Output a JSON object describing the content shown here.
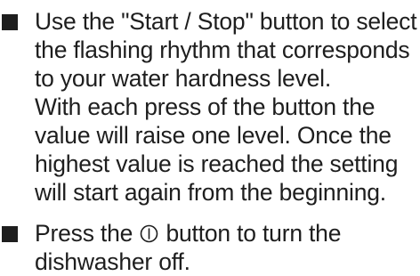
{
  "instructions": [
    {
      "lines": [
        "Use the \"Start / Stop\" button to select",
        "the flashing rhythm that corresponds",
        "to your water hardness level.",
        "With each press of the button the",
        "value will raise one level. Once the",
        "highest value is reached the setting",
        "will start again from the beginning."
      ]
    },
    {
      "line1_before": "Press the",
      "icon": "power-button-icon",
      "line1_after": "button to turn the",
      "line2": "dishwasher off."
    }
  ]
}
